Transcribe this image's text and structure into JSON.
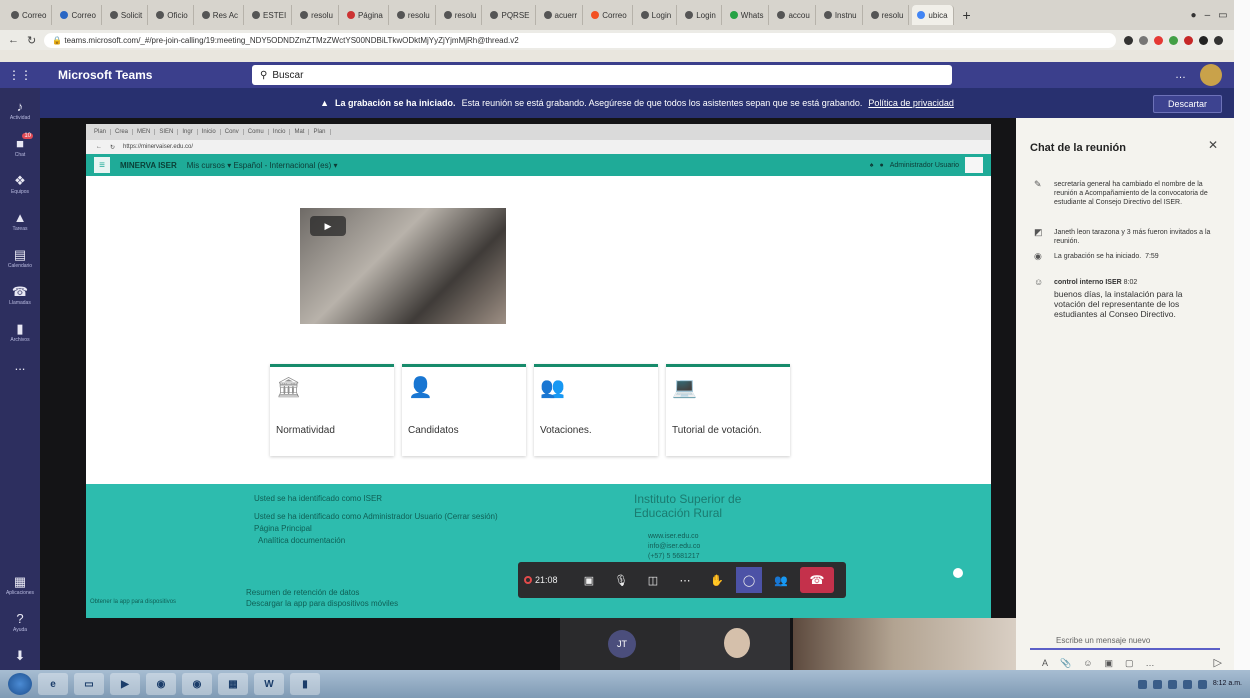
{
  "browser": {
    "tabs": [
      "Correo",
      "Correo",
      "Solicit",
      "Oficio",
      "Res Ac",
      "ESTEI",
      "resolu",
      "Página",
      "resolu",
      "resolu",
      "PQRSE",
      "acuerr",
      "Correo",
      "Login",
      "Login",
      "Whats",
      "accou",
      "Instnu",
      "resolu",
      "ubica"
    ],
    "url": "teams.microsoft.com/_#/pre-join-calling/19:meeting_NDY5ODNDZmZTMzZWctYS00NDBiLTkwODktMjYyZjYjmMjRh@thread.v2",
    "window_controls": "",
    "new_tab": "+"
  },
  "teams": {
    "brand": "Microsoft Teams",
    "search": "Buscar",
    "rail": [
      {
        "label": "Actividad",
        "icon": "bell-icon",
        "glyph": "♪"
      },
      {
        "label": "Chat",
        "icon": "chat-icon",
        "glyph": "■",
        "badge": "10"
      },
      {
        "label": "Equipos",
        "icon": "teams-icon",
        "glyph": "❖"
      },
      {
        "label": "Tareas",
        "icon": "assignments-icon",
        "glyph": "▲"
      },
      {
        "label": "Calendario",
        "icon": "calendar-icon",
        "glyph": "▤"
      },
      {
        "label": "Llamadas",
        "icon": "phone-icon",
        "glyph": "☎"
      },
      {
        "label": "Archivos",
        "icon": "files-icon",
        "glyph": "▮"
      },
      {
        "label": "...",
        "icon": "more-icon",
        "glyph": "…"
      }
    ],
    "rail_bottom": [
      {
        "label": "Aplicaciones",
        "icon": "apps-icon",
        "glyph": "▦"
      },
      {
        "label": "Ayuda",
        "icon": "help-icon",
        "glyph": "?"
      },
      {
        "label": "",
        "icon": "download-icon",
        "glyph": "⬇"
      }
    ]
  },
  "banner": {
    "bold": "La grabación se ha iniciado.",
    "text": "Esta reunión se está grabando. Asegúrese de que todos los asistentes sepan que se está grabando.",
    "link": "Política de privacidad",
    "dismiss": "Descartar"
  },
  "shared_site": {
    "inner_tabs": [
      "Plan",
      "Crea",
      "MEN",
      "SIEN",
      "Ingr",
      "Inicio",
      "Conv",
      "Comu",
      "Incio",
      "Mat",
      "Plan"
    ],
    "inner_url": "https://minervaiser.edu.co/",
    "brand": "MINERVA ISER",
    "menu": "Mis cursos ▾   Español - Internacional (es) ▾",
    "user": "Administrador Usuario",
    "cards": [
      {
        "title": "Normatividad",
        "icon": "institution-icon",
        "glyph": "🏛"
      },
      {
        "title": "Candidatos",
        "icon": "user-icon",
        "glyph": "👤"
      },
      {
        "title": "Votaciones.",
        "icon": "group-icon",
        "glyph": "👥"
      },
      {
        "title": "Tutorial de votación.",
        "icon": "tutorial-icon",
        "glyph": "💻"
      }
    ],
    "footer": {
      "line1": "Usted se ha identificado como ISER",
      "line2": "Usted se ha identificado como Administrador Usuario (Cerrar sesión)",
      "line3": "Página Principal",
      "line4": "Analítica documentación",
      "line5": "Resumen de retención de datos",
      "line6": "Descargar la app para dispositivos móviles",
      "line7": "Obtener la app para dispositivos",
      "institution": "Instituto Superior de Educación Rural",
      "contact": [
        "www.iser.edu.co",
        "info@iser.edu.co",
        "(+57) 5 5681217"
      ]
    }
  },
  "call": {
    "timer": "21:08",
    "participant_initials": "JT"
  },
  "chat": {
    "title": "Chat de la reunión",
    "messages": [
      {
        "icon": "pencil-icon",
        "glyph": "✎",
        "text": "secretaría general ha cambiado el nombre de la reunión a Acompañamiento de la convocatoria de estudiante al Consejo Directivo del ISER."
      },
      {
        "icon": "people-added-icon",
        "glyph": "◩",
        "text": "Janeth leon tarazona y 3 más fueron invitados a la reunión."
      },
      {
        "icon": "recording-icon",
        "glyph": "◉",
        "text": "La grabación se ha iniciado.",
        "time": "7:59"
      },
      {
        "icon": "avatar-icon",
        "glyph": "☺",
        "sender": "control interno ISER",
        "time": "8:02",
        "text": "buenos días, la instalación para la votación del representante de los estudiantes al Conseo Directivo."
      }
    ],
    "compose_placeholder": "Escribe un mensaje nuevo"
  },
  "taskbar": {
    "apps": [
      "",
      "",
      "",
      "",
      "",
      "",
      "W",
      ""
    ],
    "clock": "8:12 a.m."
  }
}
